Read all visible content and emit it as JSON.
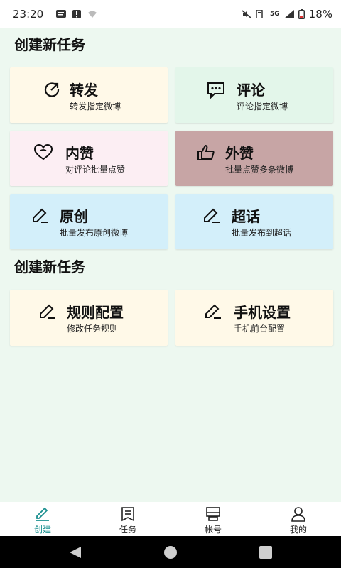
{
  "status_bar": {
    "time": "23:20",
    "network": "5G",
    "battery": "18%"
  },
  "sections": [
    {
      "title": "创建新任务"
    },
    {
      "title": "创建新任务"
    }
  ],
  "cards": [
    {
      "title": "转发",
      "desc": "转发指定微博",
      "bg": "#fff9e8",
      "icon": "share-icon"
    },
    {
      "title": "评论",
      "desc": "评论指定微博",
      "bg": "#e3f6ea",
      "icon": "comment-icon"
    },
    {
      "title": "内赞",
      "desc": "对评论批量点赞",
      "bg": "#fceef3",
      "icon": "heart-icon"
    },
    {
      "title": "外赞",
      "desc": "批量点赞多条微博",
      "bg": "#c7a5a5",
      "icon": "thumbs-up-icon"
    },
    {
      "title": "原创",
      "desc": "批量发布原创微博",
      "bg": "#d3effa",
      "icon": "edit-icon"
    },
    {
      "title": "超话",
      "desc": "批量发布到超话",
      "bg": "#d3effa",
      "icon": "edit-icon"
    },
    {
      "title": "规则配置",
      "desc": "修改任务规则",
      "bg": "#fff9e8",
      "icon": "edit-icon"
    },
    {
      "title": "手机设置",
      "desc": "手机前台配置",
      "bg": "#fff9e8",
      "icon": "edit-icon"
    }
  ],
  "nav": {
    "items": [
      {
        "label": "创建",
        "icon": "pencil-icon",
        "active": true
      },
      {
        "label": "任务",
        "icon": "task-icon",
        "active": false
      },
      {
        "label": "帐号",
        "icon": "account-icon",
        "active": false
      },
      {
        "label": "我的",
        "icon": "user-icon",
        "active": false
      }
    ],
    "active_color": "#1a8f8f"
  }
}
